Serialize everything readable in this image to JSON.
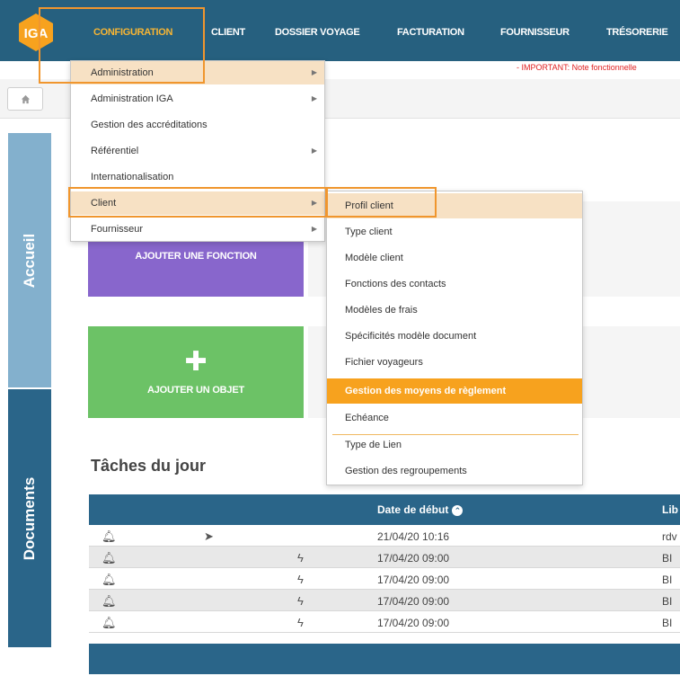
{
  "app": {
    "logo_text": "IGA",
    "brand_color": "#f7a21e",
    "header_color": "#26607f"
  },
  "nav": {
    "items": [
      {
        "label": "CONFIGURATION",
        "active": true
      },
      {
        "label": "CLIENT"
      },
      {
        "label": "DOSSIER VOYAGE"
      },
      {
        "label": "FACTURATION"
      },
      {
        "label": "FOURNISSEUR"
      },
      {
        "label": "TRÉSORERIE"
      }
    ]
  },
  "notice": {
    "text": "-   IMPORTANT: Note fonctionnelle"
  },
  "breadcrumb": {
    "home_icon": "home-icon"
  },
  "side_tabs": {
    "accueil": "Accueil",
    "documents": "Documents"
  },
  "menu": {
    "items": [
      {
        "label": "Administration",
        "has_submenu": true
      },
      {
        "label": "Administration IGA",
        "has_submenu": true
      },
      {
        "label": "Gestion des accréditations",
        "has_submenu": false
      },
      {
        "label": "Référentiel",
        "has_submenu": true
      },
      {
        "label": "Internationalisation",
        "has_submenu": false
      },
      {
        "label": "Client",
        "has_submenu": true
      },
      {
        "label": "Fournisseur",
        "has_submenu": true
      }
    ]
  },
  "submenu": {
    "items": [
      {
        "label": "Profil client"
      },
      {
        "label": "Type client"
      },
      {
        "label": "Modèle client"
      },
      {
        "label": "Fonctions des contacts"
      },
      {
        "label": "Modèles de frais"
      },
      {
        "label": "Spécificités modèle document"
      },
      {
        "label": "Fichier voyageurs"
      },
      {
        "label": "Gestion des moyens de règlement"
      },
      {
        "label": "Echéance"
      },
      {
        "label": "Type de Lien"
      },
      {
        "label": "Gestion des regroupements"
      }
    ]
  },
  "tiles": {
    "add_function": "AJOUTER UNE FONCTION",
    "add_object": "AJOUTER UN OBJET"
  },
  "tasks": {
    "title": "Tâches du jour",
    "columns": {
      "start_date": "Date de début",
      "label_partial": "Lib"
    },
    "rows": [
      {
        "date": "21/04/20 10:16",
        "lib": "rdv",
        "type_icon": "navigation-arrow-icon"
      },
      {
        "date": "17/04/20 09:00",
        "lib": "BI",
        "type_icon": "lightning-icon"
      },
      {
        "date": "17/04/20 09:00",
        "lib": "BI",
        "type_icon": "lightning-icon"
      },
      {
        "date": "17/04/20 09:00",
        "lib": "BI",
        "type_icon": "lightning-icon"
      },
      {
        "date": "17/04/20 09:00",
        "lib": "BI",
        "type_icon": "lightning-icon"
      }
    ]
  }
}
